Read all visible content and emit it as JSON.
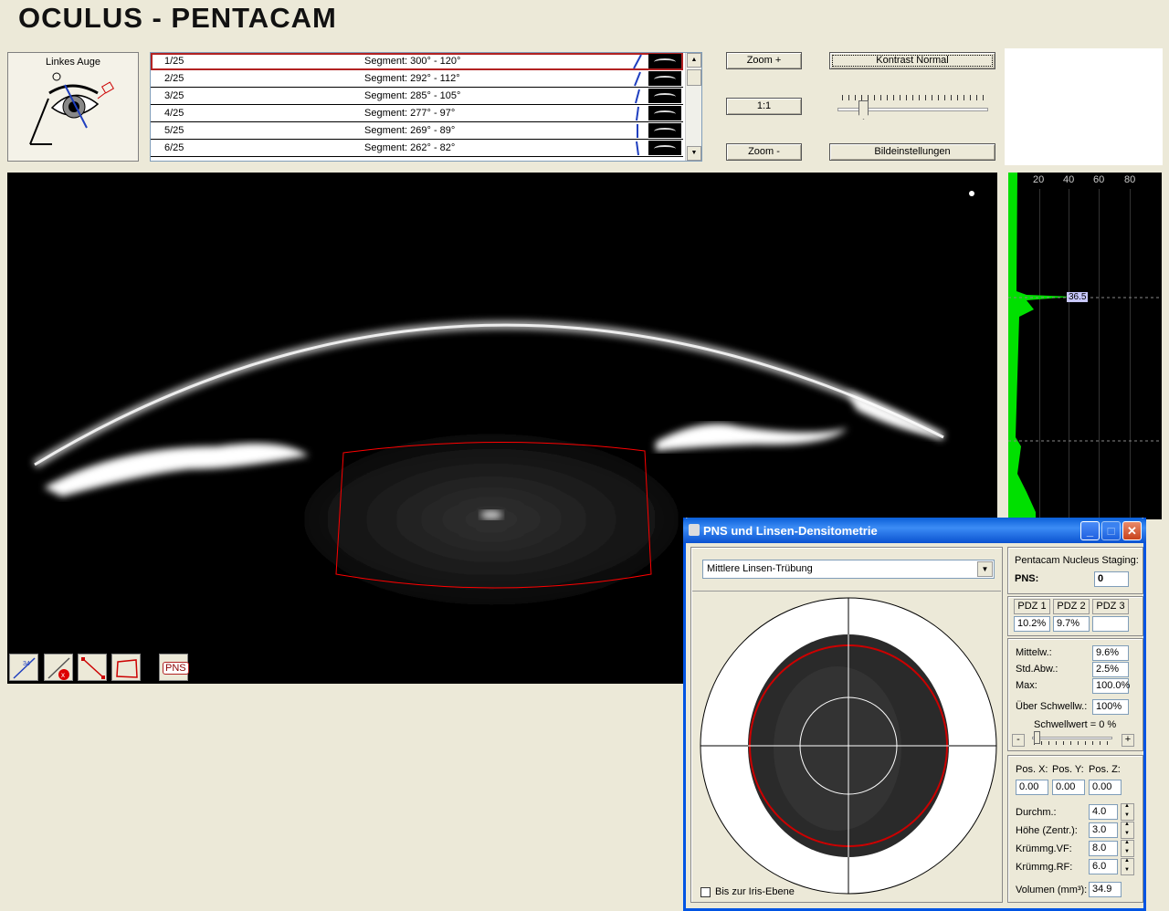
{
  "app": {
    "title": "OCULUS  -  PENTACAM"
  },
  "eye": {
    "label": "Linkes Auge"
  },
  "segments": [
    {
      "num": "1/25",
      "text": "Segment: 300° - 120°"
    },
    {
      "num": "2/25",
      "text": "Segment: 292° - 112°"
    },
    {
      "num": "3/25",
      "text": "Segment: 285° - 105°"
    },
    {
      "num": "4/25",
      "text": "Segment: 277° - 97°"
    },
    {
      "num": "5/25",
      "text": "Segment: 269° - 89°"
    },
    {
      "num": "6/25",
      "text": "Segment: 262° - 82°"
    }
  ],
  "toolbar": {
    "zoom_in": "Zoom +",
    "one_to_one": "1:1",
    "zoom_out": "Zoom -",
    "contrast": "Kontrast Normal",
    "image_settings": "Bildeinstellungen",
    "pns": "PNS"
  },
  "histogram": {
    "ticks": [
      "20",
      "40",
      "60",
      "80"
    ],
    "marker_value": "36.5"
  },
  "dialog": {
    "title": "PNS und Linsen-Densitometrie",
    "minimize": "_",
    "maximize": "□",
    "close": "✕",
    "mode_select": "Mittlere Linsen-Trübung",
    "iris_checkbox": "Bis zur Iris-Ebene",
    "staging_title": "Pentacam Nucleus Staging:",
    "pns_label": "PNS:",
    "pns_value": "0",
    "pdz": [
      {
        "label": "PDZ 1",
        "value": "10.2%"
      },
      {
        "label": "PDZ 2",
        "value": "9.7%"
      },
      {
        "label": "PDZ 3",
        "value": ""
      }
    ],
    "stats": [
      {
        "label": "Mittelw.:",
        "value": "9.6%"
      },
      {
        "label": "Std.Abw.:",
        "value": "2.5%"
      },
      {
        "label": "Max:",
        "value": "100.0%"
      },
      {
        "label": "Über Schwellw.:",
        "value": "100%"
      }
    ],
    "threshold_label": "Schwellwert = 0 %",
    "threshold_minus": "-",
    "threshold_plus": "+",
    "threshold_value": 0,
    "pos": [
      {
        "label": "Pos. X:",
        "value": "0.00"
      },
      {
        "label": "Pos. Y:",
        "value": "0.00"
      },
      {
        "label": "Pos. Z:",
        "value": "0.00"
      }
    ],
    "params": [
      {
        "label": "Durchm.:",
        "value": "4.0"
      },
      {
        "label": "Höhe (Zentr.):",
        "value": "3.0"
      },
      {
        "label": "Krümmg.VF:",
        "value": "8.0"
      },
      {
        "label": "Krümmg.RF:",
        "value": "6.0"
      }
    ],
    "volume_label": "Volumen (mm³):",
    "volume_value": "34.9"
  },
  "colors": {
    "accent": "#0054E3",
    "roi": "#FF0000",
    "histogram": "#00FF00",
    "selection": "#B22222"
  }
}
